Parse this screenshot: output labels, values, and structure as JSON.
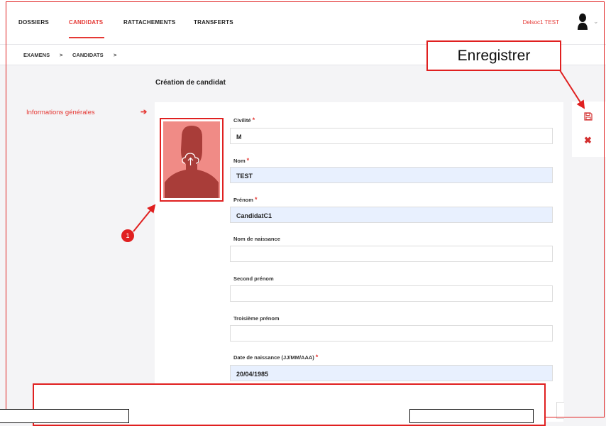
{
  "nav": {
    "tabs": [
      {
        "label": "DOSSIERS"
      },
      {
        "label": "CANDIDATS"
      },
      {
        "label": "RATTACHEMENTS"
      },
      {
        "label": "TRANSFERTS"
      }
    ],
    "active_tab": "CANDIDATS",
    "user_name": "Delsoc1 TEST",
    "chevron": "⌄"
  },
  "breadcrumb": {
    "items": [
      "EXAMENS",
      "CANDIDATS"
    ],
    "separator": ">"
  },
  "left_panel": {
    "section": "Informations générales",
    "arrow": "➔"
  },
  "page": {
    "title": "Création de candidat"
  },
  "form": {
    "photo_icon": "cloud-upload-icon",
    "fields": [
      {
        "label": "Civilité",
        "required": true,
        "value": "M",
        "filled": false
      },
      {
        "label": "Nom",
        "required": true,
        "value": "TEST",
        "filled": true
      },
      {
        "label": "Prénom",
        "required": true,
        "value": "CandidatC1",
        "filled": true
      },
      {
        "label": "Nom de naissance",
        "required": false,
        "value": "",
        "filled": false
      },
      {
        "label": "Second prénom",
        "required": false,
        "value": "",
        "filled": false
      },
      {
        "label": "Troisième prénom",
        "required": false,
        "value": "",
        "filled": false
      },
      {
        "label": "Date de naissance (JJ/MM/AAA)",
        "required": true,
        "value": "20/04/1985",
        "filled": true
      }
    ],
    "required_mark": "*"
  },
  "actions": {
    "save_icon": "save-icon",
    "close_icon": "close-icon",
    "close_glyph": "✖"
  },
  "annotations": {
    "save_callout": "Enregistrer",
    "badge": "1"
  },
  "colors": {
    "accent": "#e53935",
    "annotation_red": "#e02020",
    "filled_input": "#e8f0fe",
    "photo_bg": "#f08b86",
    "silhouette": "#a93d39"
  }
}
